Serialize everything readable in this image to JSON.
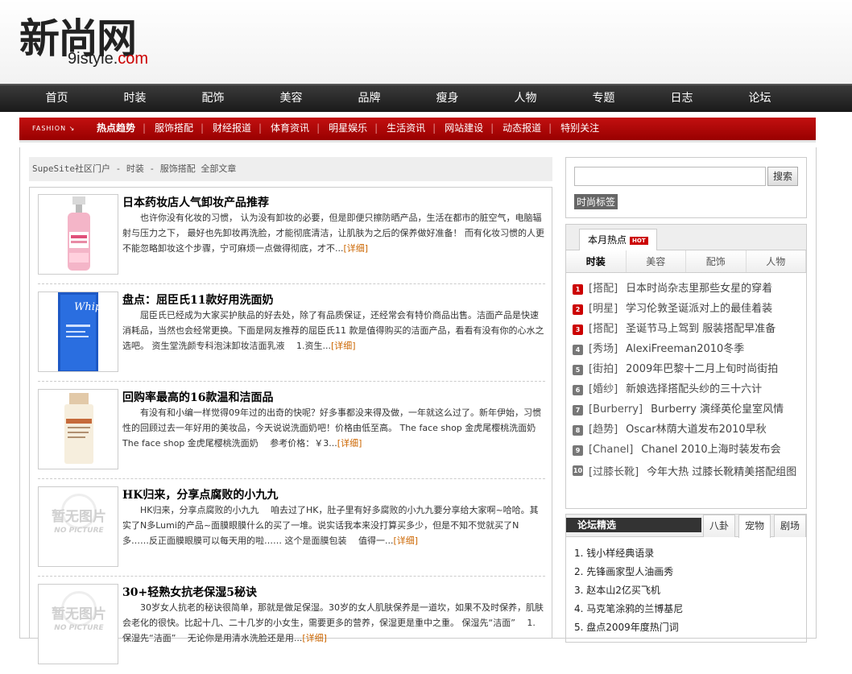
{
  "logo": {
    "cn": "新尚网",
    "en_prefix": "9istyle",
    "en_dot": ".",
    "en_suffix": "com"
  },
  "main_nav": [
    "首页",
    "时装",
    "配饰",
    "美容",
    "品牌",
    "瘦身",
    "人物",
    "专题",
    "日志",
    "论坛"
  ],
  "sub_nav": {
    "fashion_label": "FASHION ↘",
    "items": [
      "热点趋势",
      "服饰搭配",
      "财经报道",
      "体育资讯",
      "明星娱乐",
      "生活资讯",
      "网站建设",
      "动态报道",
      "特别关注"
    ]
  },
  "breadcrumb": "SupeSite社区门户 - 时装 - 服饰搭配 全部文章",
  "articles": [
    {
      "title": "日本药妆店人气卸妆产品推荐",
      "body": "也许你没有化妆的习惯， 认为没有卸妆的必要，但是即便只擦防晒产品，生活在都市的脏空气，电脑辐射与压力之下， 最好也先卸妆再洗脸，才能彻底清洁，让肌肤为之后的保养做好准备！ 而有化妆习惯的人更不能忽略卸妆这个步骤，宁可麻烦一点做得彻底，才不...",
      "more": "[详细]"
    },
    {
      "title": "盘点：屈臣氏11款好用洗面奶",
      "body": "屈臣氏已经成为大家买护肤品的好去处，除了有品质保证，还经常会有特价商品出售。洁面产品是快速消耗品，当然也会经常更换。下面是网友推荐的屈臣氏11 款是值得购买的洁面产品，看看有没有你的心水之选吧。 资生堂洗颜专科泡沫卸妆洁面乳液　 1.资生...",
      "more": "[详细]"
    },
    {
      "title": "回购率最高的16款温和洁面品",
      "body": "有没有和小编一样觉得09年过的出奇的快呢？好多事都没来得及做，一年就这么过了。新年伊始，习惯性的回顾过去一年好用的美妆品，今天说说洗面奶吧！价格由低至高。 The face shop 金虎尾樱桃洗面奶　 The face shop 金虎尾樱桃洗面奶　 参考价格：￥3...",
      "more": "[详细]"
    },
    {
      "title": "HK归来，分享点腐败的小九九",
      "body": "HK归来，分享点腐败的小九九　 咱去过了HK，肚子里有好多腐败的小九九要分享给大家啊~哈哈。其实了N多Lumi的产品~面膜眼膜什么的买了一堆。说实话我本来没打算买多少，但是不知不觉就买了N多……反正面膜眼膜可以每天用的啦…… 这个是面膜包装　 值得一...",
      "more": "[详细]"
    },
    {
      "title": "30+轻熟女抗老保湿5秘诀",
      "body": "30岁女人抗老的秘诀很简单，那就是做足保湿。30岁的女人肌肤保养是一道坎，如果不及时保养，肌肤会老化的很快。比起十几、二十几岁的小女生，需要更多的营养，保湿更是重中之重。 保湿先“洁面”　 1. 保湿先“洁面”　 无论你是用清水洗脸还是用...",
      "more": "[详细]"
    }
  ],
  "nopic": {
    "cn": "暂无图片",
    "en": "NO PICTURE"
  },
  "search": {
    "button": "搜索",
    "tags_label": "时尚标签"
  },
  "hot": {
    "tab_label": "本月热点",
    "badge": "HOT",
    "categories": [
      "时装",
      "美容",
      "配饰",
      "人物"
    ],
    "items": [
      {
        "num": "1",
        "tag": "[搭配]",
        "title": "日本时尚杂志里那些女星的穿着"
      },
      {
        "num": "2",
        "tag": "[明星]",
        "title": "学习伦敦圣诞派对上的最佳着装"
      },
      {
        "num": "3",
        "tag": "[搭配]",
        "title": "圣诞节马上驾到 服装搭配早准备"
      },
      {
        "num": "4",
        "tag": "[秀场]",
        "title": "AlexiFreeman2010冬季"
      },
      {
        "num": "5",
        "tag": "[街拍]",
        "title": "2009年巴黎十二月上旬时尚街拍"
      },
      {
        "num": "6",
        "tag": "[婚纱]",
        "title": "新娘选择搭配头纱的三十六计"
      },
      {
        "num": "7",
        "tag": "[Burberry]",
        "title": "Burberry 演绎英伦皇室风情"
      },
      {
        "num": "8",
        "tag": "[趋势]",
        "title": "Oscar林荫大道发布2010早秋"
      },
      {
        "num": "9",
        "tag": "[Chanel]",
        "title": "Chanel 2010上海时装发布会"
      },
      {
        "num": "10",
        "tag": "[过膝长靴]",
        "title": "今年大热 过膝长靴精美搭配组图"
      }
    ]
  },
  "forum": {
    "title": "论坛精选",
    "tabs": [
      "八卦",
      "宠物",
      "剧场"
    ],
    "items": [
      "1. 钱小样经典语录",
      "2. 先锋画家型人油画秀",
      "3. 赵本山2亿买飞机",
      "4. 马克笔涂鸦的兰博基尼",
      "5. 盘点2009年度热门词"
    ]
  },
  "colors": {
    "nav_red": "#b80b0b",
    "nav_dark": "#2a2a2a",
    "link_more": "#cc6600"
  }
}
